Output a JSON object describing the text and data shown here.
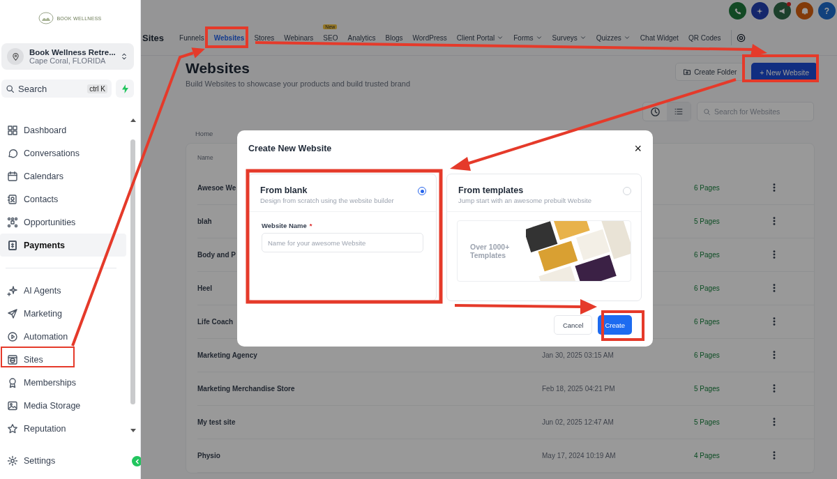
{
  "sidebar": {
    "logo_text": "BOOK WELLNESS",
    "location": {
      "name": "Book Wellness Retre...",
      "address": "Cape Coral, FLORIDA"
    },
    "search": {
      "placeholder": "Search",
      "shortcut": "ctrl K"
    },
    "groups": [
      {
        "items": [
          {
            "label": "Dashboard",
            "selected": false
          },
          {
            "label": "Conversations",
            "selected": false
          },
          {
            "label": "Calendars",
            "selected": false
          },
          {
            "label": "Contacts",
            "selected": false
          },
          {
            "label": "Opportunities",
            "selected": false
          },
          {
            "label": "Payments",
            "selected": true
          }
        ]
      },
      {
        "items": [
          {
            "label": "AI Agents",
            "selected": false
          },
          {
            "label": "Marketing",
            "selected": false
          },
          {
            "label": "Automation",
            "selected": false
          },
          {
            "label": "Sites",
            "selected": false
          },
          {
            "label": "Memberships",
            "selected": false
          },
          {
            "label": "Media Storage",
            "selected": false
          },
          {
            "label": "Reputation",
            "selected": false
          }
        ]
      }
    ],
    "settings": {
      "label": "Settings"
    }
  },
  "header": {
    "help_label": "?",
    "section_title": "Sites",
    "tabs": [
      {
        "label": "Funnels",
        "selected": false,
        "dropdown": false
      },
      {
        "label": "Websites",
        "selected": true,
        "dropdown": false
      },
      {
        "label": "Stores",
        "selected": false,
        "dropdown": false
      },
      {
        "label": "Webinars",
        "selected": false,
        "dropdown": false
      },
      {
        "label": "SEO",
        "selected": false,
        "dropdown": false,
        "badge": "New"
      },
      {
        "label": "Analytics",
        "selected": false,
        "dropdown": false
      },
      {
        "label": "Blogs",
        "selected": false,
        "dropdown": false
      },
      {
        "label": "WordPress",
        "selected": false,
        "dropdown": false
      },
      {
        "label": "Client Portal",
        "selected": false,
        "dropdown": true
      },
      {
        "label": "Forms",
        "selected": false,
        "dropdown": true
      },
      {
        "label": "Surveys",
        "selected": false,
        "dropdown": true
      },
      {
        "label": "Quizzes",
        "selected": false,
        "dropdown": true
      },
      {
        "label": "Chat Widget",
        "selected": false,
        "dropdown": false
      },
      {
        "label": "QR Codes",
        "selected": false,
        "dropdown": false
      }
    ]
  },
  "page": {
    "title": "Websites",
    "subtitle": "Build Websites to showcase your products and build trusted brand",
    "buttons": {
      "create_folder": "Create Folder",
      "new_website": "+ New Website"
    },
    "search": {
      "placeholder": "Search for Websites"
    },
    "breadcrumb": "Home",
    "table": {
      "columns": [
        "Name"
      ],
      "rows": [
        {
          "name": "Awesoe We",
          "pages": "6 Pages"
        },
        {
          "name": "blah",
          "pages": "5 Pages"
        },
        {
          "name": "Body and P",
          "pages": "6 Pages"
        },
        {
          "name": "Heel",
          "pages": "6 Pages"
        },
        {
          "name": "Life Coach",
          "pages": "6 Pages"
        },
        {
          "name": "Marketing Agency",
          "date": "Jan 30, 2025 03:15 AM",
          "pages": "6 Pages"
        },
        {
          "name": "Marketing Merchandise Store",
          "date": "Feb 18, 2025 04:21 PM",
          "pages": "5 Pages"
        },
        {
          "name": "My test site",
          "date": "Jun 02, 2025 12:47 AM",
          "pages": "5 Pages"
        },
        {
          "name": "Physio",
          "date": "May 17, 2024 10:19 AM",
          "pages": "4 Pages"
        }
      ]
    }
  },
  "modal": {
    "title": "Create New Website",
    "close": "×",
    "options": [
      {
        "kind": "blank",
        "title": "From blank",
        "description": "Design from scratch using the website builder",
        "selected": true,
        "field": {
          "label": "Website Name",
          "required_mark": "*",
          "placeholder": "Name for your awesome Website"
        }
      },
      {
        "kind": "templates",
        "title": "From templates",
        "description": "Jump start with an awesome prebuilt Website",
        "selected": false,
        "preview_text": "Over 1000+ Templates"
      }
    ],
    "buttons": {
      "cancel": "Cancel",
      "create": "Create"
    }
  }
}
